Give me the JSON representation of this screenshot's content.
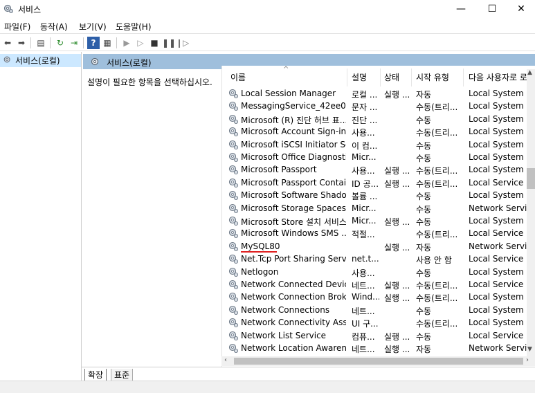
{
  "window": {
    "title": "서비스",
    "min": "—",
    "max": "☐",
    "close": "✕"
  },
  "menu": [
    "파일(F)",
    "동작(A)",
    "보기(V)",
    "도움말(H)"
  ],
  "left_pane": {
    "item": "서비스(로컬)"
  },
  "right_pane": {
    "header": "서비스(로컬)",
    "description": "설명이 필요한 항목을 선택하십시오."
  },
  "columns": {
    "name": "이름",
    "desc": "설명",
    "status": "상태",
    "startup": "시작 유형",
    "logon": "다음 사용자로 로"
  },
  "services": [
    {
      "name": "Local Session Manager",
      "desc": "로컬 ...",
      "status": "실행 ...",
      "startup": "자동",
      "logon": "Local System"
    },
    {
      "name": "MessagingService_42ee0",
      "desc": "문자 ...",
      "status": "",
      "startup": "수동(트리...",
      "logon": "Local System"
    },
    {
      "name": "Microsoft (R) 진단 허브 표...",
      "desc": "진단 ...",
      "status": "",
      "startup": "수동",
      "logon": "Local System"
    },
    {
      "name": "Microsoft Account Sign-in ...",
      "desc": "사용...",
      "status": "",
      "startup": "수동(트리...",
      "logon": "Local System"
    },
    {
      "name": "Microsoft iSCSI Initiator Se...",
      "desc": "이 컴...",
      "status": "",
      "startup": "수동",
      "logon": "Local System"
    },
    {
      "name": "Microsoft Office Diagnosti...",
      "desc": "Micr...",
      "status": "",
      "startup": "수동",
      "logon": "Local System"
    },
    {
      "name": "Microsoft Passport",
      "desc": "사용...",
      "status": "실행 ...",
      "startup": "수동(트리...",
      "logon": "Local System"
    },
    {
      "name": "Microsoft Passport Container",
      "desc": "ID 공...",
      "status": "실행 ...",
      "startup": "수동(트리...",
      "logon": "Local Service"
    },
    {
      "name": "Microsoft Software Shado...",
      "desc": "볼륨 ...",
      "status": "",
      "startup": "수동",
      "logon": "Local System"
    },
    {
      "name": "Microsoft Storage Spaces ...",
      "desc": "Micr...",
      "status": "",
      "startup": "수동",
      "logon": "Network Service"
    },
    {
      "name": "Microsoft Store 설치 서비스",
      "desc": "Micr...",
      "status": "실행 ...",
      "startup": "수동",
      "logon": "Local System"
    },
    {
      "name": "Microsoft Windows SMS ...",
      "desc": "적절...",
      "status": "",
      "startup": "수동(트리...",
      "logon": "Local Service"
    },
    {
      "name": "MySQL80",
      "desc": "",
      "status": "실행 ...",
      "startup": "자동",
      "logon": "Network Service"
    },
    {
      "name": "Net.Tcp Port Sharing Service",
      "desc": "net.t...",
      "status": "",
      "startup": "사용 안 함",
      "logon": "Local Service"
    },
    {
      "name": "Netlogon",
      "desc": "사용...",
      "status": "",
      "startup": "수동",
      "logon": "Local System"
    },
    {
      "name": "Network Connected Device...",
      "desc": "네트...",
      "status": "실행 ...",
      "startup": "수동(트리...",
      "logon": "Local Service"
    },
    {
      "name": "Network Connection Broker",
      "desc": "Wind...",
      "status": "실행 ...",
      "startup": "수동(트리...",
      "logon": "Local System"
    },
    {
      "name": "Network Connections",
      "desc": "네트...",
      "status": "",
      "startup": "수동",
      "logon": "Local System"
    },
    {
      "name": "Network Connectivity Assis...",
      "desc": "UI 구...",
      "status": "",
      "startup": "수동(트리...",
      "logon": "Local System"
    },
    {
      "name": "Network List Service",
      "desc": "컴퓨...",
      "status": "실행 ...",
      "startup": "수동",
      "logon": "Local Service"
    },
    {
      "name": "Network Location Awareness",
      "desc": "네트...",
      "status": "실행 ...",
      "startup": "자동",
      "logon": "Network Service"
    }
  ],
  "tabs": [
    "확장",
    "표준"
  ],
  "colors": {
    "selection": "#cce8ff",
    "pane_header": "#9fbfdc",
    "annotation_underline": "#e02020"
  }
}
